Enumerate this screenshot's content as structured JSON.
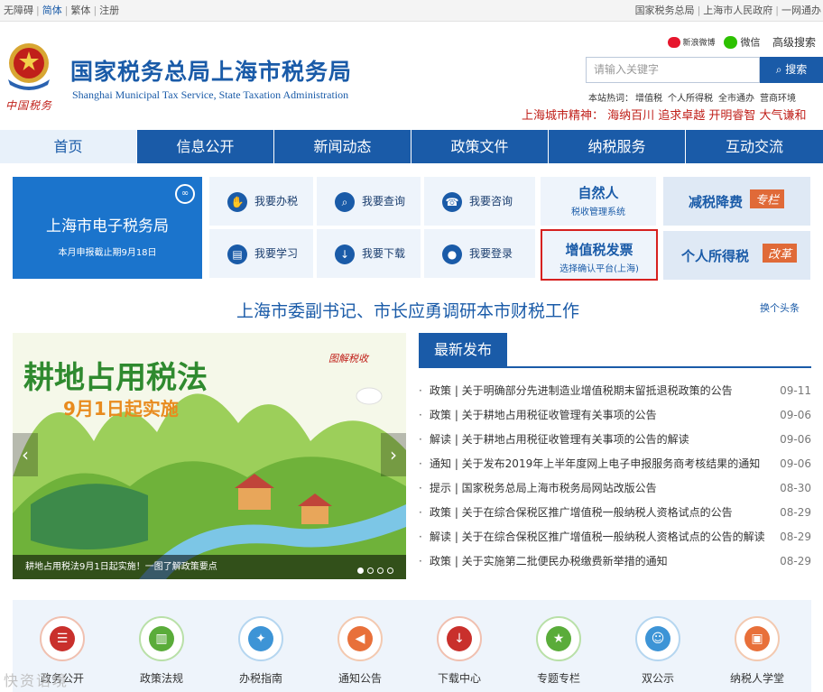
{
  "topbar": {
    "left": [
      "无障碍",
      "简体",
      "繁体",
      "注册"
    ],
    "right": [
      "国家税务总局",
      "上海市人民政府",
      "一网通办"
    ]
  },
  "header": {
    "slogan_mark": "中国税务",
    "title": "国家税务总局上海市税务局",
    "subtitle": "Shanghai Municipal Tax Service, State Taxation Administration",
    "weibo": "新浪微博",
    "wechat": "微信",
    "advanced_search": "高级搜索",
    "search_placeholder": "请输入关键字",
    "search_button": "搜索",
    "hot_label": "本站热词：",
    "hot_words": [
      "增值税",
      "个人所得税",
      "全市通办",
      "营商环境"
    ],
    "spirit": "上海城市精神：  海纳百川 追求卓越 开明睿智 大气谦和"
  },
  "nav": [
    "首页",
    "信息公开",
    "新闻动态",
    "政策文件",
    "纳税服务",
    "互动交流"
  ],
  "services": {
    "etax_title": "上海市电子税务局",
    "etax_sub": "本月申报截止期9月18日",
    "tiles": [
      "我要办税",
      "我要查询",
      "我要咨询",
      "我要学习",
      "我要下载",
      "我要登录"
    ],
    "promo1": {
      "title": "自然人",
      "sub": "税收管理系统"
    },
    "promo2": {
      "title": "减税降费",
      "tag": "专栏"
    },
    "promo3": {
      "title": "增值税发票",
      "sub": "选择确认平台(上海)"
    },
    "promo4": {
      "title": "个人所得税",
      "tag": "改革"
    }
  },
  "headline": {
    "text": "上海市委副书记、市长应勇调研本市财税工作",
    "swap": "换个头条"
  },
  "slider": {
    "big_title": "耕地占用税法",
    "date_title": "9月1日起实施",
    "badge": "图解税收",
    "caption": "耕地占用税法9月1日起实施！一图了解政策要点"
  },
  "news": {
    "tab": "最新发布",
    "items": [
      {
        "text": "政策 | 关于明确部分先进制造业增值税期末留抵退税政策的公告",
        "date": "09-11"
      },
      {
        "text": "政策 | 关于耕地占用税征收管理有关事项的公告",
        "date": "09-06"
      },
      {
        "text": "解读 | 关于耕地占用税征收管理有关事项的公告的解读",
        "date": "09-06"
      },
      {
        "text": "通知 | 关于发布2019年上半年度网上电子申报服务商考核结果的通知",
        "date": "09-06"
      },
      {
        "text": "提示 | 国家税务总局上海市税务局网站改版公告",
        "date": "08-30"
      },
      {
        "text": "政策 | 关于在综合保税区推广增值税一般纳税人资格试点的公告",
        "date": "08-29"
      },
      {
        "text": "解读 | 关于在综合保税区推广增值税一般纳税人资格试点的公告的解读",
        "date": "08-29"
      },
      {
        "text": "政策 | 关于实施第二批便民办税缴费新举措的通知",
        "date": "08-29"
      }
    ]
  },
  "bottom": [
    "政务公开",
    "政策法规",
    "办税指南",
    "通知公告",
    "下载中心",
    "专题专栏",
    "双公示",
    "纳税人学堂"
  ],
  "watermark": "快资语境",
  "colors": {
    "primary": "#1a5ba8",
    "accent_red": "#c0201a",
    "tag_orange": "#e06a38"
  }
}
